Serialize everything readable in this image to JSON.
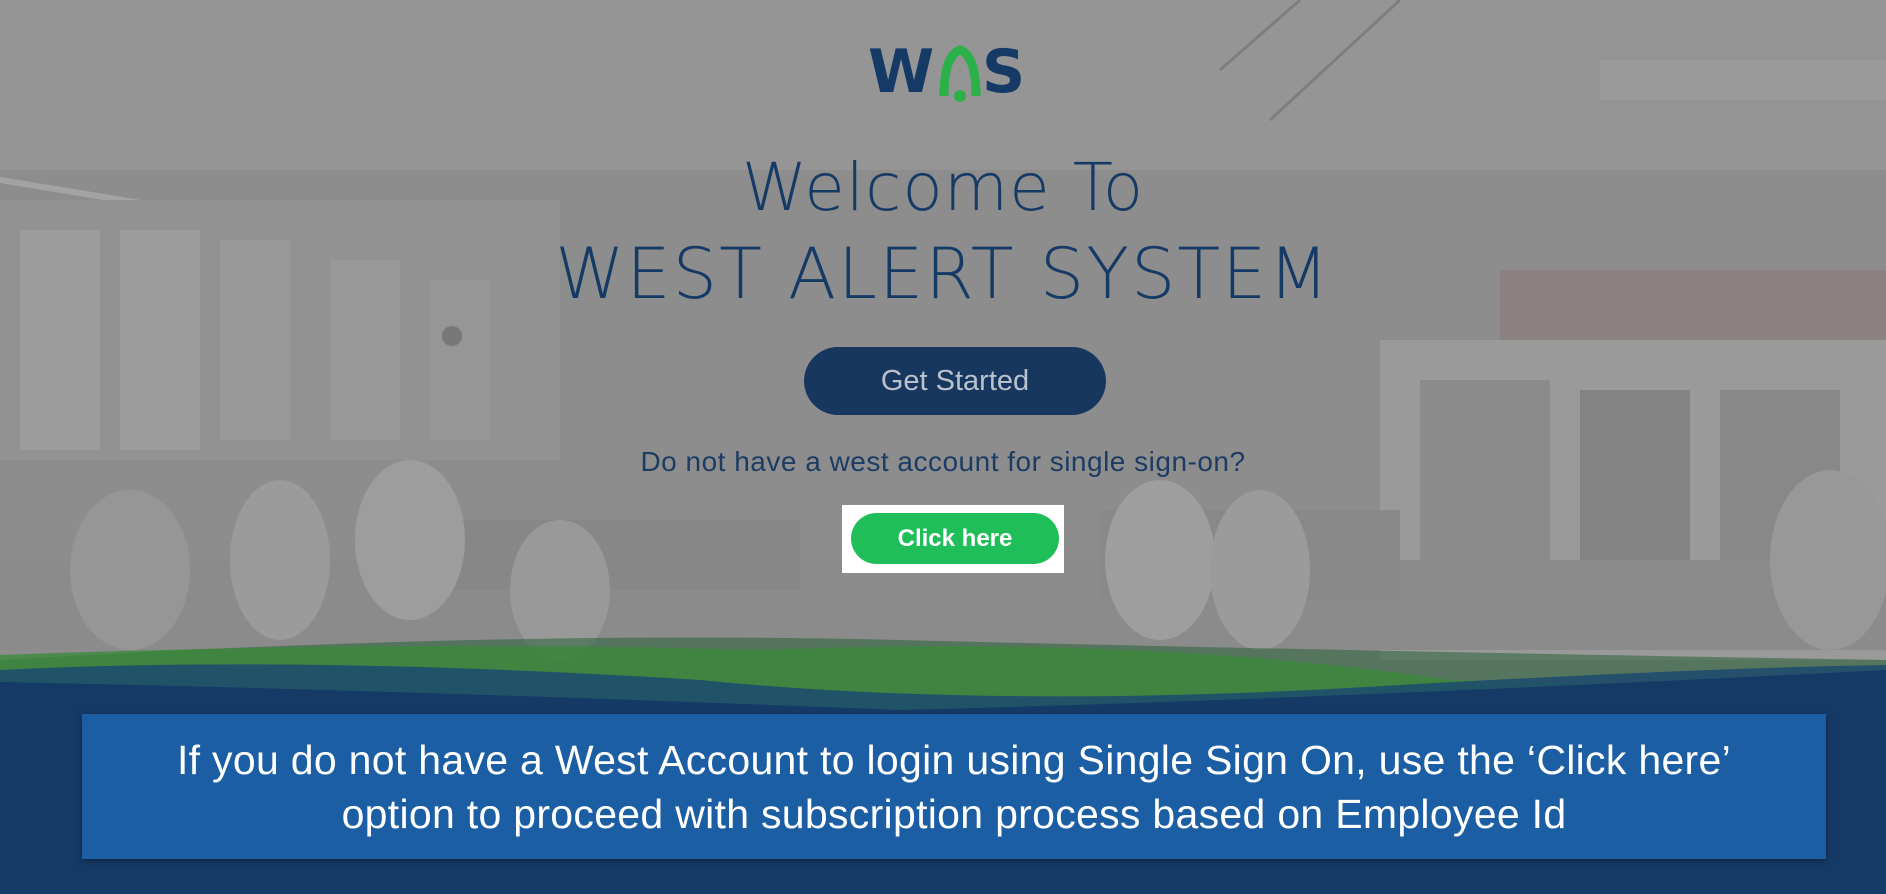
{
  "logo": {
    "text": "WAS",
    "icon": "bell-icon",
    "color_primary": "#163a66",
    "color_accent": "#2bb04a"
  },
  "hero": {
    "welcome": "Welcome To",
    "system_name": "WEST ALERT SYSTEM"
  },
  "actions": {
    "get_started_label": "Get Started",
    "no_account_prompt": "Do not have a west account for single sign-on?",
    "click_here_label": "Click here"
  },
  "callout": {
    "line1": "If you do not have a West Account to login using Single Sign On, use the ‘Click here’",
    "line2": "option to proceed with subscription process based on Employee Id"
  },
  "colors": {
    "brand_navy": "#17375f",
    "brand_green": "#1fbe58",
    "callout_blue": "#1c5ea4"
  }
}
